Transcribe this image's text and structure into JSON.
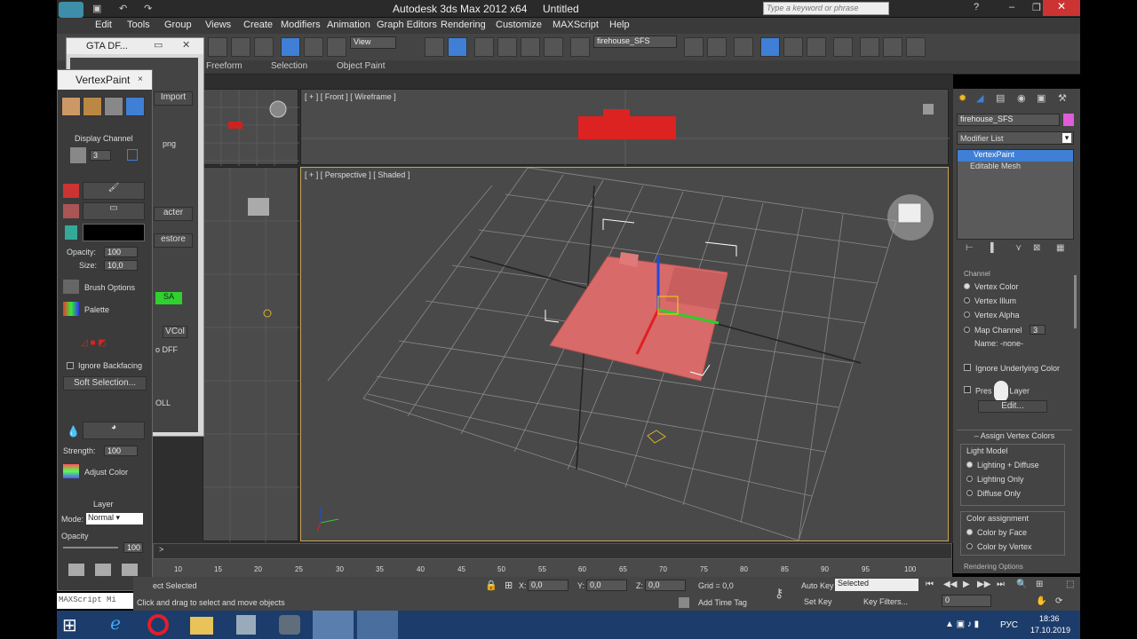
{
  "window": {
    "title": "Autodesk 3ds Max  2012 x64",
    "doc": "Untitled",
    "search_placeholder": "Type a keyword or phrase"
  },
  "menu": [
    "Edit",
    "Tools",
    "Group",
    "Views",
    "Create",
    "Modifiers",
    "Animation",
    "Graph Editors",
    "Rendering",
    "Customize",
    "MAXScript",
    "Help"
  ],
  "toolbar": {
    "view_select": "View",
    "selection_set": "firehouse_SFS"
  },
  "ribbon": [
    "Freeform",
    "Selection",
    "Object Paint"
  ],
  "viewports": {
    "front_label": "[ + ] [ Front ] [ Wireframe ]",
    "persp_label": "[ + ] [ Perspective ] [ Shaded ]"
  },
  "gta_panel": {
    "title": "GTA DF...",
    "items": [
      "Import DFF",
      "Import",
      "png",
      "acter",
      "estore",
      "SA",
      "VCol",
      "o DFF",
      "OLL"
    ]
  },
  "vertexpaint": {
    "title": "VertexPaint",
    "display_channel": "Display Channel",
    "channel_value": "3",
    "opacity_label": "Opacity:",
    "opacity_value": "100",
    "size_label": "Size:",
    "size_value": "10,0",
    "brush_options": "Brush Options",
    "palette": "Palette",
    "ignore_backfacing": "Ignore Backfacing",
    "soft_selection": "Soft Selection...",
    "strength_label": "Strength:",
    "strength_value": "100",
    "adjust_color": "Adjust Color",
    "layer": "Layer",
    "mode_label": "Mode:",
    "mode_value": "Normal",
    "opacity2_label": "Opacity",
    "opacity2_value": "100",
    "maxscript": "MAXScript Mi"
  },
  "command_panel": {
    "object_name": "firehouse_SFS",
    "modifier_list": "Modifier List",
    "stack": [
      "VertexPaint",
      "Editable Mesh"
    ],
    "channel_header": "Channel",
    "channel_options": [
      "Vertex Color",
      "Vertex Illum",
      "Vertex Alpha",
      "Map Channel"
    ],
    "map_channel_value": "3",
    "name_label": "Name: -none-",
    "ignore_underlying": "Ignore Underlying Color",
    "preserve_layer": "Pres",
    "preserve_layer2": "Layer",
    "edit_btn": "Edit...",
    "assign_header": "Assign Vertex Colors",
    "light_model": "Light Model",
    "light_options": [
      "Lighting + Diffuse",
      "Lighting Only",
      "Diffuse Only"
    ],
    "color_assignment": "Color assignment",
    "color_options": [
      "Color by Face",
      "Color by Vertex"
    ],
    "rendering_options": "Rendering Options"
  },
  "timeline": {
    "ticks": [
      "10",
      "15",
      "20",
      "25",
      "30",
      "35",
      "40",
      "45",
      "50",
      "55",
      "60",
      "65",
      "70",
      "75",
      "80",
      "85",
      "90",
      "95",
      "100"
    ]
  },
  "status": {
    "selected": "ect Selected",
    "hint": "Click and drag to select and move objects",
    "x_label": "X:",
    "x_value": "0,0",
    "y_label": "Y:",
    "y_value": "0,0",
    "z_label": "Z:",
    "z_value": "0,0",
    "grid": "Grid = 0,0",
    "add_time_tag": "Add Time Tag",
    "auto_key": "Auto Key",
    "set_key": "Set Key",
    "key_select": "Selected",
    "key_filters": "Key Filters...",
    "frame": "0"
  },
  "tray": {
    "lang": "РУС",
    "time": "18:36",
    "date": "17.10.2019"
  },
  "colors": {
    "accent_blue": "#3f7fd6",
    "mesh_red": "#d86a6a",
    "vp_bg": "#4a4a4a"
  }
}
